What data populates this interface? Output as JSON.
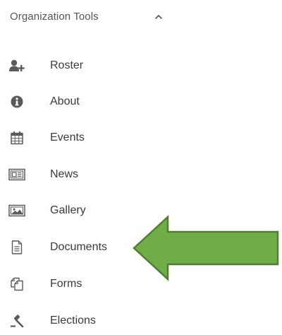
{
  "section": {
    "title": "Organization Tools",
    "expanded": true
  },
  "nav": {
    "items": [
      {
        "label": "Roster",
        "icon": "add-user-icon"
      },
      {
        "label": "About",
        "icon": "info-icon"
      },
      {
        "label": "Events",
        "icon": "calendar-icon"
      },
      {
        "label": "News",
        "icon": "newspaper-icon"
      },
      {
        "label": "Gallery",
        "icon": "image-icon"
      },
      {
        "label": "Documents",
        "icon": "document-icon"
      },
      {
        "label": "Forms",
        "icon": "forms-icon"
      },
      {
        "label": "Elections",
        "icon": "gavel-icon"
      }
    ]
  },
  "colors": {
    "icon": "#5a5a5a",
    "arrow_fill": "#70AD47",
    "arrow_stroke": "#507E32"
  }
}
